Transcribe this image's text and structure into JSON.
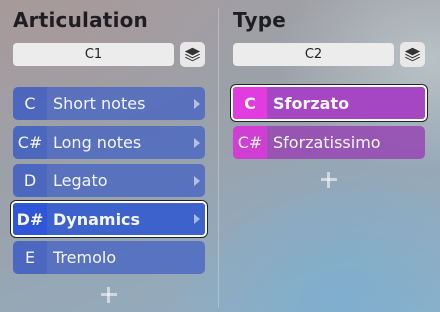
{
  "articulation": {
    "heading": "Articulation",
    "selector_value": "C1",
    "items": [
      {
        "key": "C",
        "label": "Short notes",
        "has_submenu": true,
        "selected": false
      },
      {
        "key": "C#",
        "label": "Long notes",
        "has_submenu": true,
        "selected": false
      },
      {
        "key": "D",
        "label": "Legato",
        "has_submenu": true,
        "selected": false
      },
      {
        "key": "D#",
        "label": "Dynamics",
        "has_submenu": true,
        "selected": true
      },
      {
        "key": "E",
        "label": "Tremolo",
        "has_submenu": false,
        "selected": false
      }
    ]
  },
  "type": {
    "heading": "Type",
    "selector_value": "C2",
    "items": [
      {
        "key": "C",
        "label": "Sforzato",
        "selected": true
      },
      {
        "key": "C#",
        "label": "Sforzatissimo",
        "selected": false
      }
    ]
  },
  "icons": {
    "layers": "layers-icon",
    "add": "plus-icon",
    "submenu": "chevron-right-icon"
  },
  "colors": {
    "articulation_item": "#4664c3",
    "articulation_selected": "#3d62cc",
    "type_item": "#9646b4",
    "type_key": "#e23be0",
    "selected_border": "#ffffff"
  }
}
